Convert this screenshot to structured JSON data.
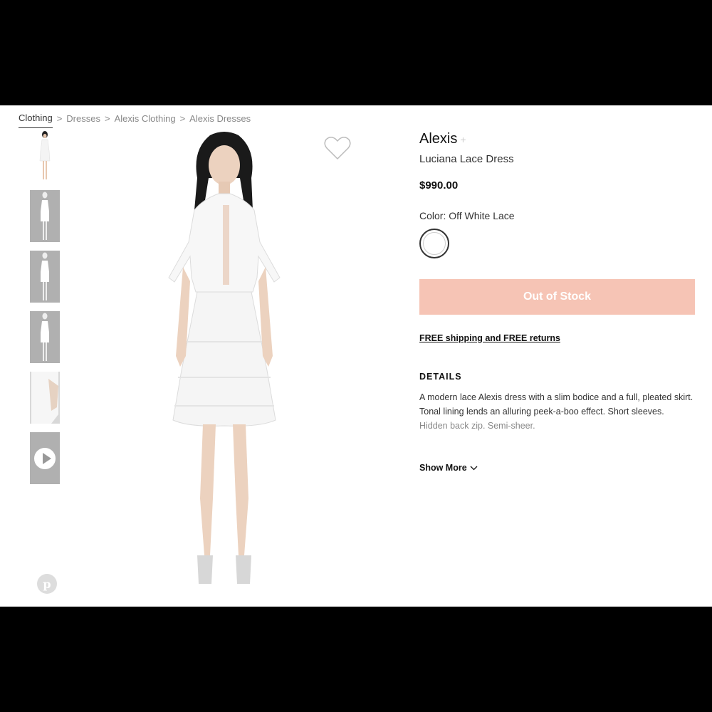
{
  "breadcrumb": {
    "items": [
      "Clothing",
      "Dresses",
      "Alexis Clothing",
      "Alexis Dresses"
    ],
    "separator": ">"
  },
  "product": {
    "brand": "Alexis",
    "brand_plus": "+",
    "name": "Luciana Lace Dress",
    "price": "$990.00",
    "color_label": "Color: Off White Lace",
    "stock_button": "Out of Stock",
    "shipping_text": "FREE shipping and FREE returns",
    "details_heading": "DETAILS",
    "details_text": "A modern lace Alexis dress with a slim bodice and a full, pleated skirt. Tonal lining lends an alluring peek-a-boo effect. Short sleeves.",
    "details_text_faded": "Hidden back zip. Semi-sheer.",
    "show_more": "Show More"
  },
  "icons": {
    "wishlist": "heart-outline-icon",
    "video": "play-icon",
    "pinterest": "pinterest-icon",
    "show_more": "chevron-down-icon"
  },
  "pinterest_glyph": "p",
  "colors": {
    "out_of_stock_bg": "#f6c4b5",
    "thumb_grey": "#b0b0b0"
  }
}
